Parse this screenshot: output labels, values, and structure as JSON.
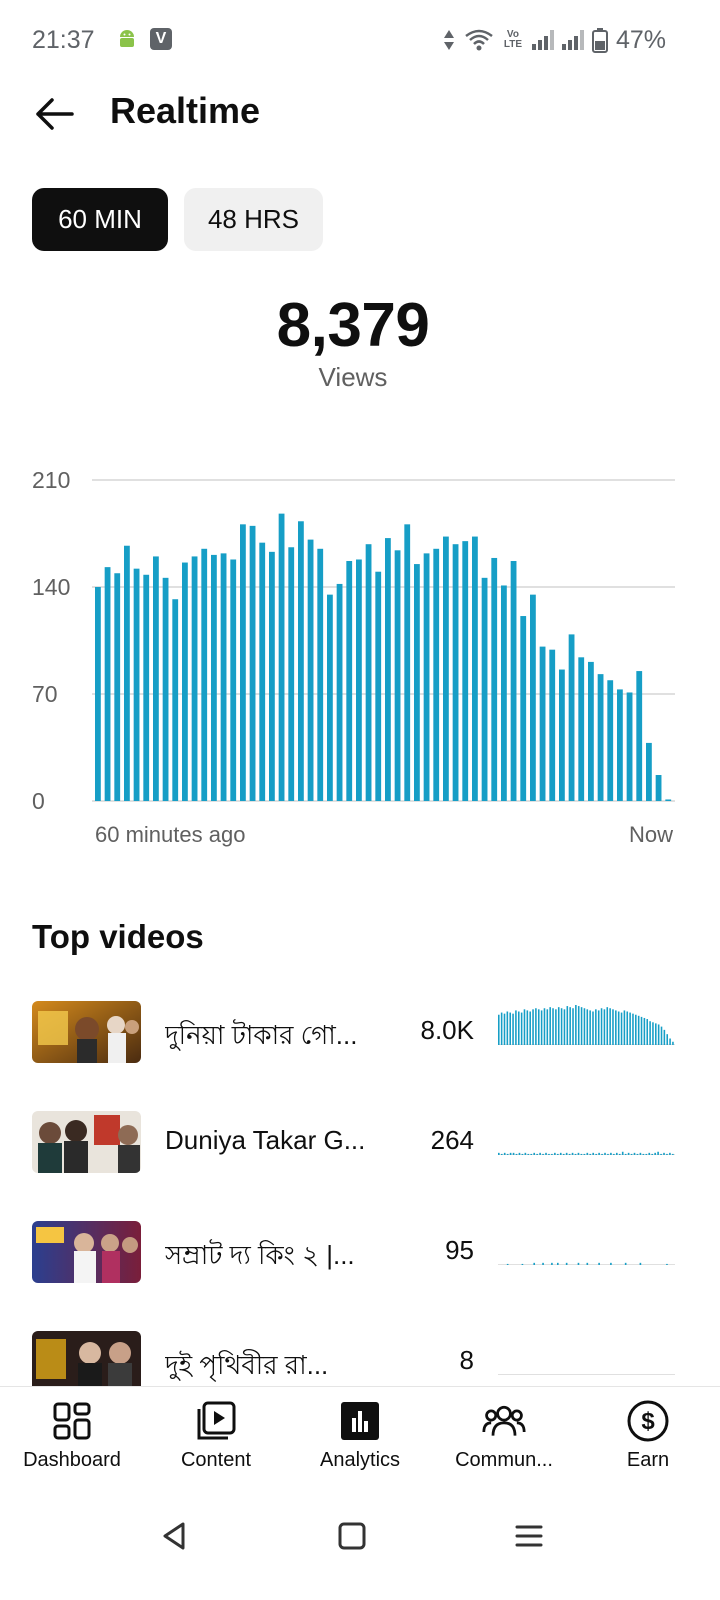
{
  "status": {
    "time": "21:37",
    "battery": "47%",
    "volte": "Vo LTE"
  },
  "header": {
    "title": "Realtime",
    "back_icon": "arrow-left-icon"
  },
  "range_tabs": [
    {
      "label": "60 MIN",
      "selected": true
    },
    {
      "label": "48 HRS",
      "selected": false
    }
  ],
  "summary": {
    "total": "8,379",
    "label": "Views"
  },
  "chart_data": {
    "type": "bar",
    "title": "",
    "xlabel": "",
    "ylabel": "",
    "x_start_label": "60 minutes ago",
    "x_end_label": "Now",
    "y_ticks": [
      "0",
      "70",
      "140",
      "210"
    ],
    "ylim": [
      0,
      210
    ],
    "grid": true,
    "color": "#169ec6",
    "values": [
      140,
      153,
      149,
      167,
      152,
      148,
      160,
      146,
      132,
      156,
      160,
      165,
      161,
      162,
      158,
      181,
      180,
      169,
      163,
      188,
      166,
      183,
      171,
      165,
      135,
      142,
      157,
      158,
      168,
      150,
      172,
      164,
      181,
      155,
      162,
      165,
      173,
      168,
      170,
      173,
      146,
      159,
      141,
      157,
      121,
      135,
      101,
      99,
      86,
      109,
      94,
      91,
      83,
      79,
      73,
      71,
      85,
      38,
      17,
      1
    ]
  },
  "top_videos": {
    "title": "Top videos",
    "items": [
      {
        "title": "দুনিয়া টাকার গো...",
        "views": "8.0K",
        "spark": [
          28,
          30,
          29,
          31,
          30,
          29,
          32,
          31,
          30,
          33,
          32,
          31,
          33,
          34,
          33,
          32,
          34,
          33,
          35,
          34,
          33,
          35,
          34,
          33,
          36,
          35,
          34,
          37,
          36,
          35,
          34,
          33,
          32,
          31,
          33,
          32,
          34,
          33,
          35,
          34,
          33,
          32,
          31,
          30,
          32,
          31,
          30,
          29,
          28,
          27,
          26,
          25,
          24,
          22,
          21,
          20,
          19,
          17,
          14,
          10,
          6,
          3
        ]
      },
      {
        "title": "Duniya Takar G...",
        "views": "264",
        "spark": [
          2,
          1,
          2,
          1,
          2,
          2,
          1,
          2,
          1,
          2,
          1,
          1,
          2,
          1,
          2,
          1,
          2,
          1,
          1,
          2,
          1,
          2,
          1,
          2,
          1,
          2,
          1,
          2,
          1,
          1,
          2,
          1,
          2,
          1,
          2,
          1,
          2,
          1,
          2,
          1,
          2,
          1,
          3,
          1,
          2,
          1,
          2,
          1,
          2,
          1,
          1,
          2,
          1,
          2,
          3,
          1,
          2,
          1,
          2,
          1
        ]
      },
      {
        "title": "সম্রাট দ্য কিং ২ |...",
        "views": "95",
        "spark": [
          0,
          0,
          0,
          1,
          0,
          0,
          0,
          0,
          1,
          0,
          0,
          0,
          2,
          0,
          0,
          2,
          0,
          0,
          2,
          0,
          2,
          0,
          0,
          2,
          0,
          0,
          0,
          2,
          0,
          0,
          2,
          0,
          0,
          0,
          2,
          0,
          0,
          0,
          2,
          0,
          0,
          0,
          0,
          2,
          0,
          0,
          0,
          0,
          2,
          0,
          0,
          0,
          0,
          0,
          0,
          0,
          0,
          1,
          0,
          0
        ]
      },
      {
        "title": "দুই পৃথিবীর রা...",
        "views": "8",
        "spark": [
          0,
          0,
          0,
          0,
          0,
          0,
          0,
          0,
          0,
          0,
          0,
          0,
          0,
          0,
          0,
          0,
          0,
          0,
          0,
          0,
          0,
          0,
          0,
          0,
          0,
          0,
          0,
          0,
          0,
          0
        ]
      }
    ]
  },
  "bottom_nav": [
    {
      "label": "Dashboard",
      "icon": "dashboard-grid-icon",
      "active": false
    },
    {
      "label": "Content",
      "icon": "content-play-icon",
      "active": false
    },
    {
      "label": "Analytics",
      "icon": "analytics-bar-icon",
      "active": true
    },
    {
      "label": "Commun...",
      "icon": "community-people-icon",
      "active": false
    },
    {
      "label": "Earn",
      "icon": "earn-dollar-icon",
      "active": false
    }
  ],
  "system_nav": [
    "back-triangle-icon",
    "home-square-icon",
    "menu-lines-icon"
  ]
}
